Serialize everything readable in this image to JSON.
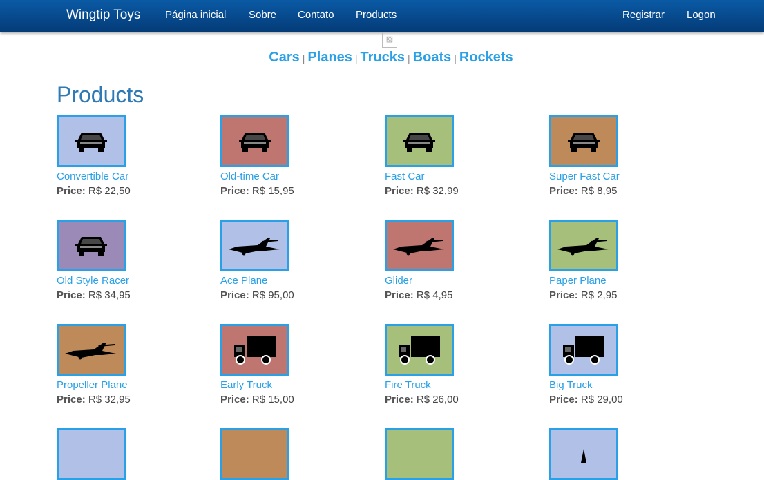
{
  "nav": {
    "brand": "Wingtip Toys",
    "links": [
      "Página inicial",
      "Sobre",
      "Contato",
      "Products"
    ],
    "right": [
      "Registrar",
      "Logon"
    ]
  },
  "categories": [
    "Cars",
    "Planes",
    "Trucks",
    "Boats",
    "Rockets"
  ],
  "separator": "|",
  "page_title": "Products",
  "price_label": "Price:",
  "products": [
    {
      "name": "Convertible Car",
      "price": "R$ 22,50",
      "icon": "car-icon",
      "bg": "#b0c0e6"
    },
    {
      "name": "Old-time Car",
      "price": "R$ 15,95",
      "icon": "car-icon",
      "bg": "#bf7570"
    },
    {
      "name": "Fast Car",
      "price": "R$ 32,99",
      "icon": "car-icon",
      "bg": "#a6bf7a"
    },
    {
      "name": "Super Fast Car",
      "price": "R$ 8,95",
      "icon": "car-icon",
      "bg": "#bf8a5a"
    },
    {
      "name": "Old Style Racer",
      "price": "R$ 34,95",
      "icon": "car-icon",
      "bg": "#9b8ab8"
    },
    {
      "name": "Ace Plane",
      "price": "R$ 95,00",
      "icon": "plane-icon",
      "bg": "#b0c0e6"
    },
    {
      "name": "Glider",
      "price": "R$ 4,95",
      "icon": "plane-icon",
      "bg": "#bf7570"
    },
    {
      "name": "Paper Plane",
      "price": "R$ 2,95",
      "icon": "plane-icon",
      "bg": "#a6bf7a"
    },
    {
      "name": "Propeller Plane",
      "price": "R$ 32,95",
      "icon": "plane-icon",
      "bg": "#bf8a5a"
    },
    {
      "name": "Early Truck",
      "price": "R$ 15,00",
      "icon": "truck-icon",
      "bg": "#bf7570"
    },
    {
      "name": "Fire Truck",
      "price": "R$ 26,00",
      "icon": "truck-icon",
      "bg": "#a6bf7a"
    },
    {
      "name": "Big Truck",
      "price": "R$ 29,00",
      "icon": "truck-icon",
      "bg": "#b0c0e6"
    },
    {
      "name": "",
      "price": "",
      "icon": "",
      "bg": "#b0c0e6"
    },
    {
      "name": "",
      "price": "",
      "icon": "",
      "bg": "#bf8a5a"
    },
    {
      "name": "",
      "price": "",
      "icon": "",
      "bg": "#a6bf7a"
    },
    {
      "name": "",
      "price": "",
      "icon": "rocket-icon",
      "bg": "#b0c0e6"
    }
  ]
}
